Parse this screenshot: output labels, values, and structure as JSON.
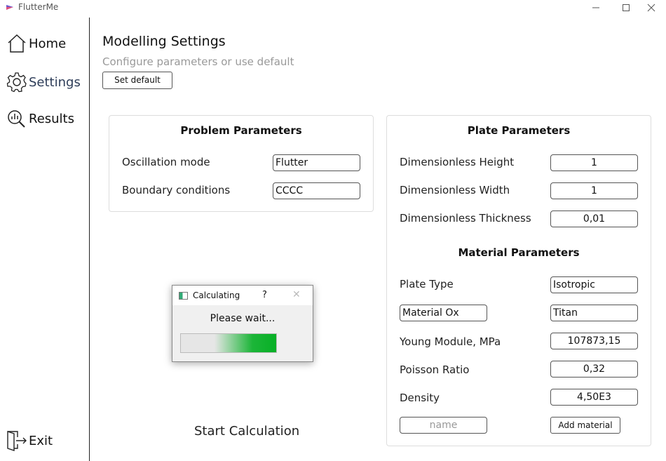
{
  "window": {
    "title": "FlutterMe"
  },
  "sidebar": {
    "items": [
      {
        "label": "Home"
      },
      {
        "label": "Settings"
      },
      {
        "label": "Results"
      }
    ],
    "exit_label": "Exit"
  },
  "header": {
    "title": "Modelling Settings",
    "subtitle": "Configure parameters or use default",
    "set_default_label": "Set default"
  },
  "problem": {
    "title": "Problem Parameters",
    "oscillation_label": "Oscillation mode",
    "oscillation_value": "Flutter",
    "boundary_label": "Boundary conditions",
    "boundary_value": "CCCC"
  },
  "plate": {
    "title": "Plate Parameters",
    "height_label": "Dimensionless Height",
    "height_value": "1",
    "width_label": "Dimensionless Width",
    "width_value": "1",
    "thickness_label": "Dimensionless Thickness",
    "thickness_value": "0,01"
  },
  "material": {
    "title": "Material Parameters",
    "plate_type_label": "Plate Type",
    "plate_type_value": "Isotropic",
    "material_select": "Material Ox",
    "material_value": "Titan",
    "young_label": "Young Module, MPa",
    "young_value": "107873,15",
    "poisson_label": "Poisson Ratio",
    "poisson_value": "0,32",
    "density_label": "Density",
    "density_value": "4,50E3",
    "name_placeholder": "name",
    "add_label": "Add material"
  },
  "start_label": "Start Calculation",
  "dialog": {
    "title": "Calculating",
    "help": "?",
    "close": "✕",
    "message": "Please wait...",
    "progress_color": "#06b025"
  }
}
